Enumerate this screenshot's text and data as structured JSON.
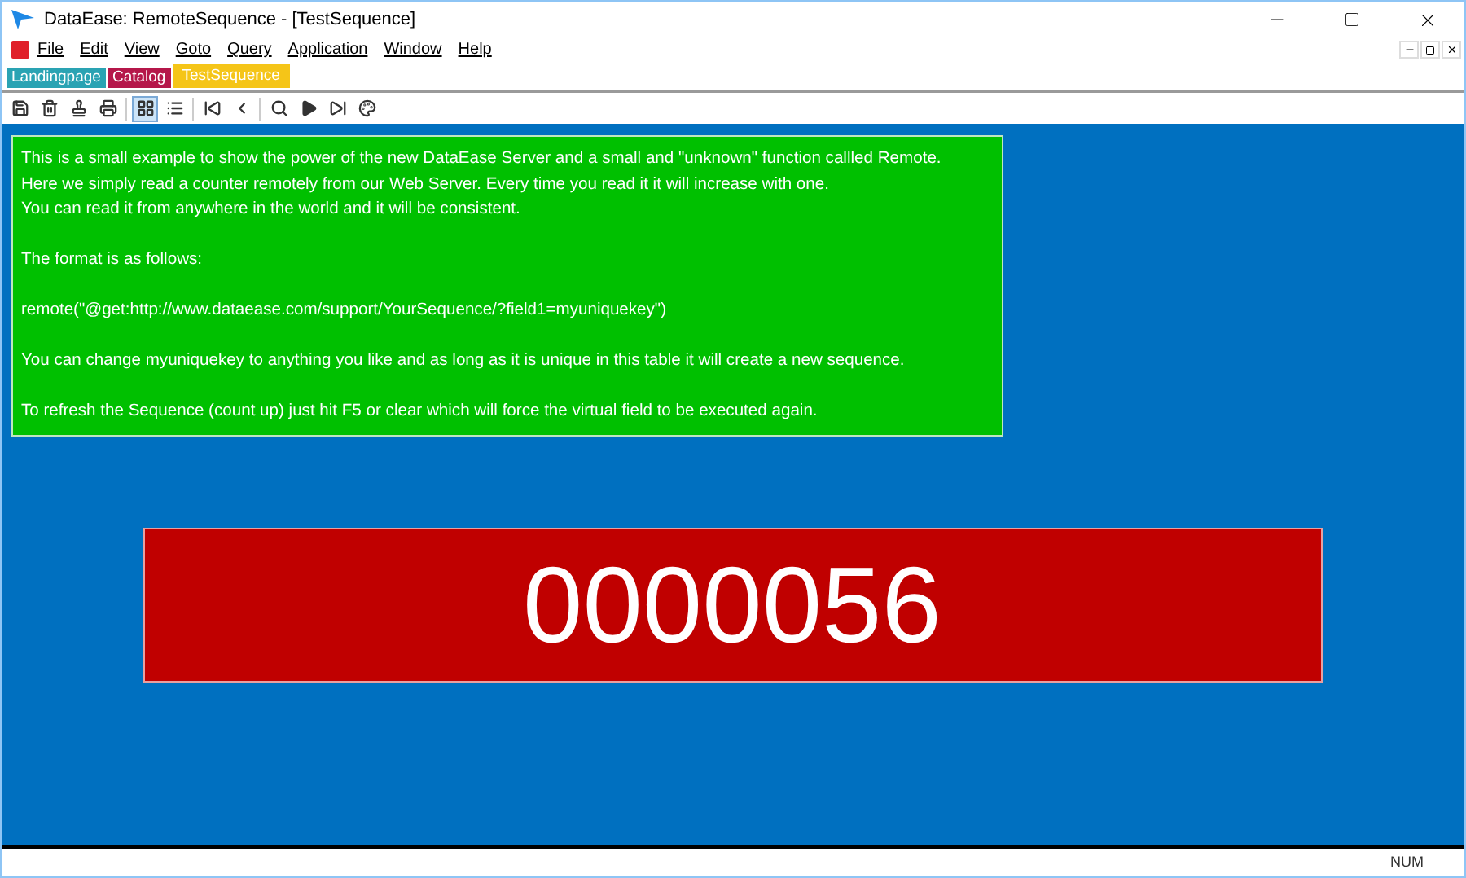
{
  "window": {
    "title": "DataEase: RemoteSequence - [TestSequence]"
  },
  "menu": [
    "File",
    "Edit",
    "View",
    "Goto",
    "Query",
    "Application",
    "Window",
    "Help"
  ],
  "tabs": [
    {
      "label": "Landingpage",
      "color": "#2aa3b3",
      "selected": false
    },
    {
      "label": "Catalog",
      "color": "#b5174a",
      "selected": false
    },
    {
      "label": "TestSequence",
      "color": "#f5c518",
      "selected": true
    }
  ],
  "toolbar": [
    {
      "kind": "save",
      "selected": false
    },
    {
      "kind": "delete",
      "selected": false
    },
    {
      "kind": "stamp",
      "selected": false
    },
    {
      "kind": "print",
      "selected": false
    },
    {
      "kind": "sep"
    },
    {
      "kind": "form",
      "selected": true
    },
    {
      "kind": "list",
      "selected": false
    },
    {
      "kind": "sep"
    },
    {
      "kind": "first",
      "selected": false
    },
    {
      "kind": "prev",
      "selected": false
    },
    {
      "kind": "sep"
    },
    {
      "kind": "search",
      "selected": false
    },
    {
      "kind": "next",
      "selected": false
    },
    {
      "kind": "last",
      "selected": false
    },
    {
      "kind": "palette",
      "selected": false
    }
  ],
  "info_paragraphs": [
    [
      "This is a small example to show the power of the new DataEase Server and a small and \"unknown\" function callled Remote.",
      "Here we simply read a counter remotely from our Web Server. Every time you read it it will increase with one.",
      "You can read it from anywhere in the world and it will be consistent."
    ],
    [
      "The format is as follows:"
    ],
    [
      "remote(\"@get:http://www.dataease.com/support/YourSequence/?field1=myuniquekey\")"
    ],
    [
      "You can change myuniquekey to anything you like and as long as it is unique in this table it will create a new sequence."
    ],
    [
      "To refresh the Sequence (count up) just hit F5 or clear which will force the virtual field to be executed again."
    ]
  ],
  "counter": "0000056",
  "status_bar": {
    "num": "NUM"
  }
}
